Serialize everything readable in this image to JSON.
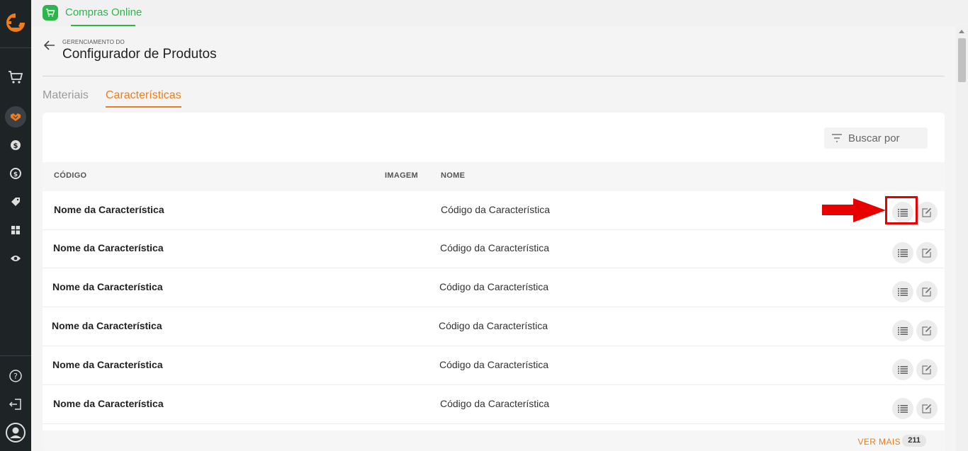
{
  "app": {
    "title": "Compras Online",
    "icon": "shopping-cart-icon",
    "color": "#2cb54a"
  },
  "header": {
    "breadcrumb": "GERENCIAMENTO DO",
    "title": "Configurador de Produtos"
  },
  "tabs": [
    {
      "label": "Materiais",
      "active": false
    },
    {
      "label": "Características",
      "active": true
    }
  ],
  "search": {
    "placeholder": "Buscar por",
    "icon": "filter-icon"
  },
  "table": {
    "columns": [
      "CÓDIGO",
      "IMAGEM",
      "NOME"
    ],
    "rows": [
      {
        "name": "Nome da Característica",
        "code": "Código da Característica"
      },
      {
        "name": "Nome da Característica",
        "code": "Código da Característica"
      },
      {
        "name": "Nome da Característica",
        "code": "Código da Característica"
      },
      {
        "name": "Nome da Característica",
        "code": "Código da Característica"
      },
      {
        "name": "Nome da Característica",
        "code": "Código da Característica"
      },
      {
        "name": "Nome da Característica",
        "code": "Código da Característica"
      }
    ],
    "row_actions": [
      "list-icon",
      "edit-icon"
    ]
  },
  "footer": {
    "more_label": "VER MAIS",
    "count": "211"
  },
  "colors": {
    "accent": "#e67e22",
    "sidebar": "#1e2326",
    "highlight": "#e60000"
  },
  "sidebar": {
    "top_icons": [
      "logo-icon",
      "cart-icon",
      "handshake-icon",
      "money-icon",
      "exchange-icon",
      "tag-icon",
      "grid-icon",
      "eye-icon"
    ],
    "bottom_icons": [
      "help-icon",
      "logout-icon",
      "user-avatar-icon"
    ]
  }
}
